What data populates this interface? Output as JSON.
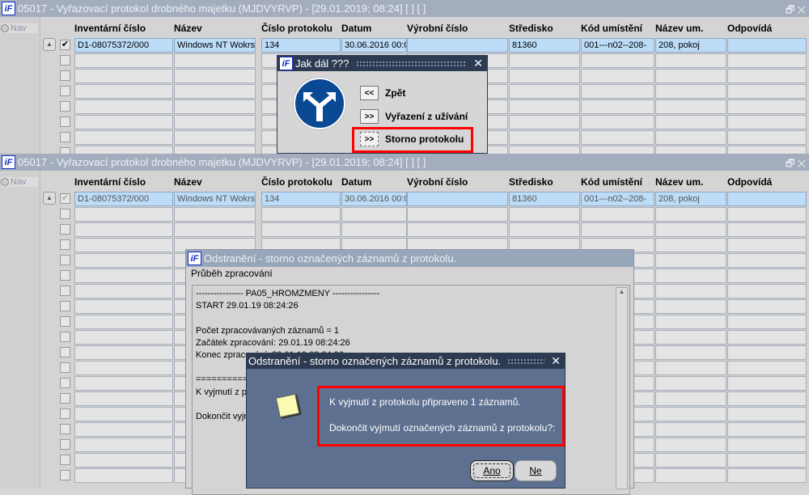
{
  "window_title": "05017 - Vyřazovací protokol drobného majetku (MJDVYRVP) - [29.01.2019; 08:24]  [ ]  [ ]",
  "nav_label": "Nav",
  "restore_icon": "restore-icon",
  "columns": [
    "Inventární číslo",
    "Název",
    "Číslo protokolu",
    "Datum",
    "Výrobní číslo",
    "Středisko",
    "Kód umístění",
    "Název um.",
    "Odpovídá"
  ],
  "row1": [
    "D1-08075372/000",
    "Windows NT Wokrs",
    "134",
    "30.06.2016 00:0",
    "",
    "81360",
    "001---n02--208-",
    "208, pokoj",
    ""
  ],
  "jak_dal": {
    "title": "Jak dál ???",
    "options": [
      {
        "btn": "<<",
        "label": "Zpět"
      },
      {
        "btn": ">>",
        "label": "Vyřazení z užívání"
      },
      {
        "btn": ">>",
        "label": "Storno protokolu"
      }
    ]
  },
  "progress": {
    "title": "Odstranění - storno označených záznamů z protokolu.",
    "label": "Průběh zpracování",
    "lines": [
      "---------------- PA05_HROMZMENY ----------------",
      "START 29.01.19 08:24:26",
      "",
      "Počet zpracovávaných záznamů = 1",
      "Začátek zpracování: 29.01.19 08:24:26",
      "Konec zpracování: 29.01.19 08:24:26",
      "",
      "==========",
      "K vyjmutí z pr",
      "",
      "Dokončit vyjm"
    ]
  },
  "confirm": {
    "title": "Odstranění - storno označených záznamů z protokolu.",
    "message1": "K vyjmutí z protokolu připraveno 1 záznamů.",
    "message2": "Dokončit vyjmutí označených záznamů z protokolu?:",
    "yes": "Ano",
    "no": "Ne"
  },
  "colors": {
    "highlight": "#ff0000",
    "selected_row": "#bcdcf8",
    "dark_title": "#2c3a52",
    "dialog_body": "#5d7090"
  }
}
